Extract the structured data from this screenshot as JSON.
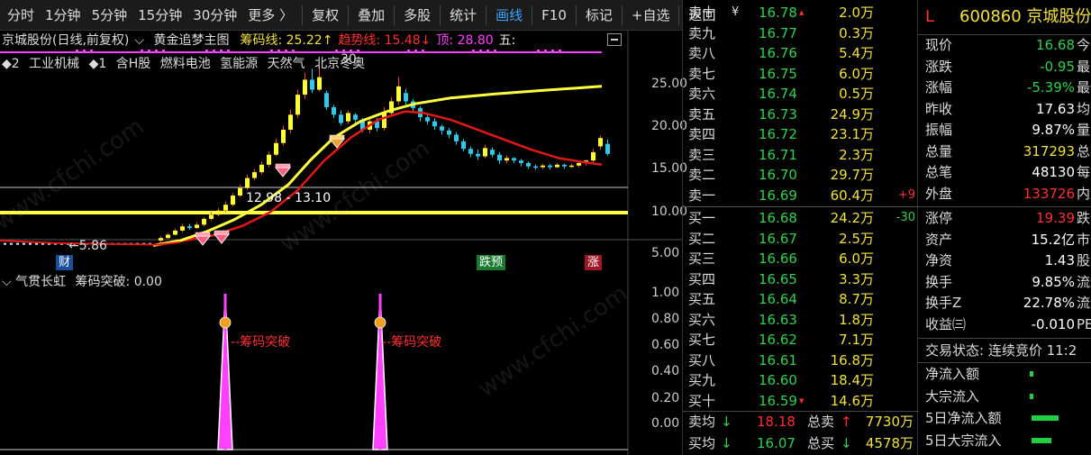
{
  "toolbar": {
    "left": [
      "分时",
      "1分钟",
      "5分钟",
      "15分钟",
      "30分钟",
      "更多 〉"
    ],
    "right": [
      "复权",
      "叠加",
      "多股",
      "统计",
      "画线",
      "F10",
      "标记",
      "+自选",
      "返回"
    ],
    "active": "画线"
  },
  "chart": {
    "stock_label": "京城股份(日线,前复权)",
    "indicator_name": "黄金追梦主图",
    "chip_line": "筹码线: 25.22↑",
    "trend_line": "趋势线: 15.48↓",
    "top_value": "顶: 28.80",
    "five_value": "五:",
    "concepts": [
      "◆2",
      "工业机械",
      "◆1",
      "含H股",
      "燃料电池",
      "氢能源",
      "天然气",
      "北京冬奥"
    ],
    "axis_labels": [
      "25.00",
      "20.00",
      "15.00",
      "10.00",
      "5.00"
    ],
    "range_label": "12.98 - 13.10",
    "low_label": "←5.86",
    "fragment_label": "30",
    "badges": {
      "cai": "财",
      "dieyu": "跌预",
      "zhang": "涨"
    },
    "colors": {
      "up": "#ff3030",
      "down": "#30c8e8",
      "yellow": "#ffff40",
      "ma": "#e01818",
      "white": "#ffffff"
    }
  },
  "sub_chart": {
    "name": "气贯长虹",
    "value_label": "筹码突破: 0.00",
    "signal_label": "--筹码突破",
    "axis_labels": [
      "1.00",
      "0.80",
      "0.60",
      "0.40",
      "0.20",
      "0.00"
    ]
  },
  "orderbook": {
    "asks": [
      {
        "label": "卖十",
        "price": "16.78",
        "vol": "2.0万"
      },
      {
        "label": "卖九",
        "price": "16.77",
        "vol": "0.3万"
      },
      {
        "label": "卖八",
        "price": "16.76",
        "vol": "5.4万"
      },
      {
        "label": "卖七",
        "price": "16.75",
        "vol": "6.0万"
      },
      {
        "label": "卖六",
        "price": "16.74",
        "vol": "0.5万"
      },
      {
        "label": "卖五",
        "price": "16.73",
        "vol": "24.9万"
      },
      {
        "label": "卖四",
        "price": "16.72",
        "vol": "23.1万"
      },
      {
        "label": "卖三",
        "price": "16.71",
        "vol": "2.3万"
      },
      {
        "label": "卖二",
        "price": "16.70",
        "vol": "29.7万"
      },
      {
        "label": "卖一",
        "price": "16.69",
        "vol": "60.4万"
      }
    ],
    "bids": [
      {
        "label": "买一",
        "price": "16.68",
        "vol": "24.2万"
      },
      {
        "label": "买二",
        "price": "16.67",
        "vol": "2.5万"
      },
      {
        "label": "买三",
        "price": "16.66",
        "vol": "6.0万"
      },
      {
        "label": "买四",
        "price": "16.65",
        "vol": "3.3万"
      },
      {
        "label": "买五",
        "price": "16.64",
        "vol": "8.7万"
      },
      {
        "label": "买六",
        "price": "16.63",
        "vol": "1.8万"
      },
      {
        "label": "买七",
        "price": "16.62",
        "vol": "7.1万"
      },
      {
        "label": "买八",
        "price": "16.61",
        "vol": "16.8万"
      },
      {
        "label": "买九",
        "price": "16.60",
        "vol": "18.4万"
      },
      {
        "label": "买十",
        "price": "16.59",
        "vol": "14.6万"
      }
    ],
    "ask_top_mark": "¥",
    "ask_change": "+9",
    "bid_change": "-30",
    "summary": [
      {
        "label": "卖均",
        "arrow": "↓",
        "price": "18.18",
        "lab2": "总卖",
        "arrow2": "↑",
        "val": "7730万"
      },
      {
        "label": "买均",
        "arrow": "↓",
        "price": "16.07",
        "lab2": "总买",
        "arrow2": "↓",
        "val": "4578万"
      }
    ]
  },
  "quote": {
    "flag": "L",
    "code_name": "600860 京城股份",
    "rows1": [
      {
        "label": "现价",
        "value": "16.68",
        "color": "#30d050",
        "lab2": "今开"
      },
      {
        "label": "涨跌",
        "value": "-0.95",
        "color": "#30d050",
        "lab2": "最高"
      },
      {
        "label": "涨幅",
        "value": "-5.39%",
        "color": "#30d050",
        "lab2": "最低"
      },
      {
        "label": "昨收",
        "value": "17.63",
        "color": "#ffffff",
        "lab2": "均价"
      },
      {
        "label": "振幅",
        "value": "9.87%",
        "color": "#ffffff",
        "lab2": "量比"
      },
      {
        "label": "总量",
        "value": "317293",
        "color": "#f0e040",
        "lab2": "总额"
      },
      {
        "label": "总笔",
        "value": "48130",
        "color": "#ffffff",
        "lab2": "每笔"
      },
      {
        "label": "外盘",
        "value": "133726",
        "color": "#ff3030",
        "lab2": "内盘"
      }
    ],
    "rows2": [
      {
        "label": "涨停",
        "value": "19.39",
        "color": "#ff3030",
        "lab2": "跌停"
      },
      {
        "label": "资产",
        "value": "15.2亿",
        "color": "#ffffff",
        "lab2": "市值"
      },
      {
        "label": "净资",
        "value": "1.43",
        "color": "#ffffff",
        "lab2": "股本"
      },
      {
        "label": "换手",
        "value": "9.85%",
        "color": "#ffffff",
        "lab2": "流通"
      },
      {
        "label": "换手Z",
        "value": "22.78%",
        "color": "#ffffff",
        "lab2": "流通"
      },
      {
        "label": "收益㈢",
        "value": "-0.010",
        "color": "#ffffff",
        "lab2": "PE(动"
      }
    ],
    "trade_status": "交易状态: 连续竞价 11:2",
    "flows": [
      "净流入额",
      "大宗流入",
      "5日净流入额",
      "5日大宗流入"
    ]
  }
}
